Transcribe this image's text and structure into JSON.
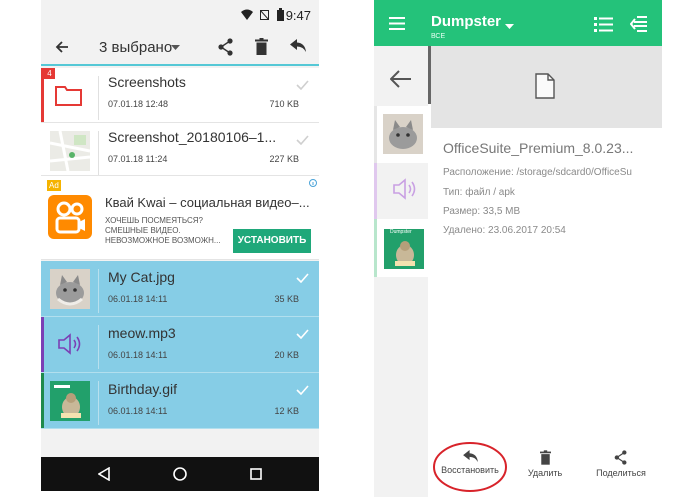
{
  "left": {
    "status": {
      "time": "9:47"
    },
    "toolbar": {
      "title": "3 выбрано"
    },
    "items": [
      {
        "name": "Screenshots",
        "date": "07.01.18 12:48",
        "size": "710 KB",
        "badge": "4",
        "selected": false
      },
      {
        "name": "Screenshot_20180106–1...",
        "date": "07.01.18 11:24",
        "size": "227 KB",
        "selected": false
      },
      {
        "name": "My Cat.jpg",
        "date": "06.01.18 14:11",
        "size": "35 KB",
        "selected": true
      },
      {
        "name": "meow.mp3",
        "date": "06.01.18 14:11",
        "size": "20 KB",
        "selected": true
      },
      {
        "name": "Birthday.gif",
        "date": "06.01.18 14:11",
        "size": "12 KB",
        "selected": true
      }
    ],
    "ad": {
      "badge": "Ad",
      "title": "Квай Kwai – социальная видео–...",
      "line1": "ХОЧЕШЬ ПОСМЕЯТЬСЯ?",
      "line2": "СМЕШНЫЕ ВИДЕО.",
      "line3": "НЕВОЗМОЖНОЕ ВОЗМОЖН...",
      "button": "УСТАНОВИТЬ"
    }
  },
  "right": {
    "toolbar": {
      "title": "Dumpster",
      "subtitle": "ВСЕ"
    },
    "thumb_label": "Dumpster",
    "detail": {
      "filename": "OfficeSuite_Premium_8.0.23...",
      "location": "Расположение: /storage/sdcard0/OfficeSu",
      "type": "Тип: файл / apk",
      "size": "Размер: 33,5 MB",
      "deleted": "Удалено: 23.06.2017 20:54"
    },
    "actions": {
      "restore": "Восстановить",
      "delete": "Удалить",
      "share": "Поделиться"
    }
  },
  "colors": {
    "accent_green": "#24c27a",
    "selection_blue": "#86cde6",
    "ad_button": "#1fa87a",
    "highlight_circle": "#d8232a"
  }
}
